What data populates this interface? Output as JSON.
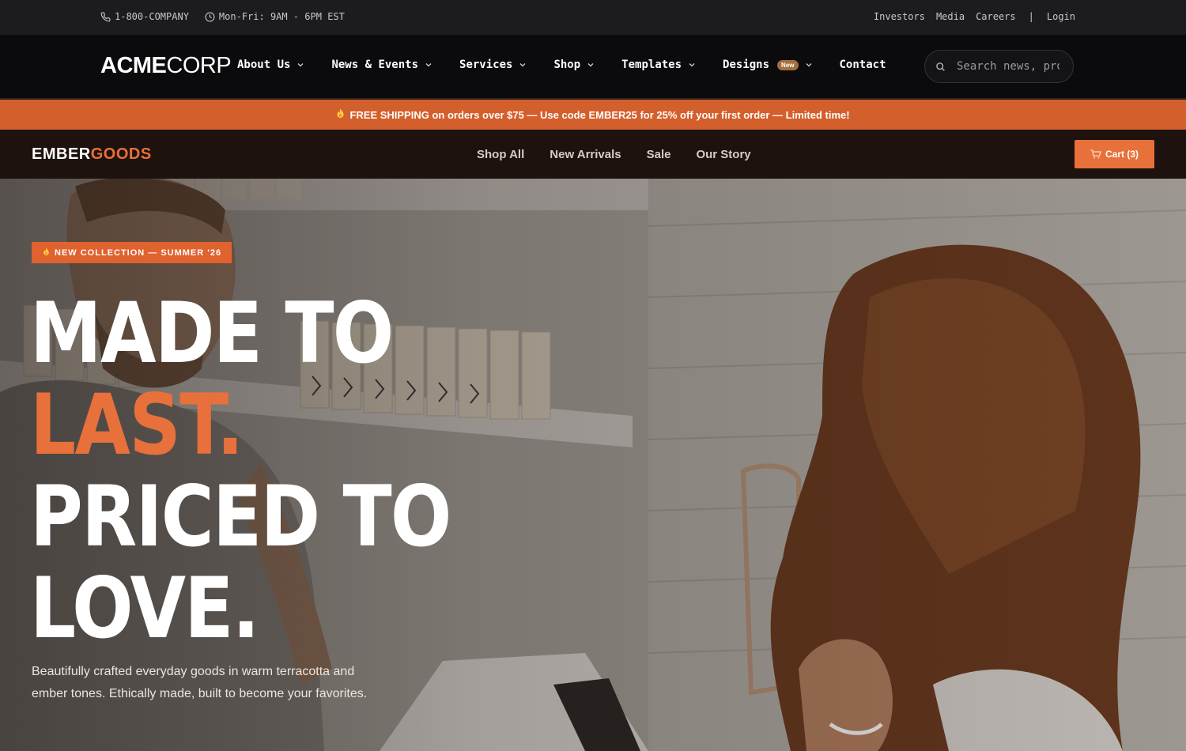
{
  "utility": {
    "phone": "1-800-COMPANY",
    "hours": "Mon-Fri: 9AM - 6PM EST",
    "links": [
      "Investors",
      "Media",
      "Careers"
    ],
    "separator": "|",
    "login": "Login",
    "phone_icon": "phone-icon",
    "clock_icon": "clock-icon"
  },
  "nav": {
    "brand_bold": "ACME",
    "brand_light": "CORP",
    "items": [
      {
        "label": "About Us",
        "dropdown": true
      },
      {
        "label": "News & Events",
        "dropdown": true
      },
      {
        "label": "Services",
        "dropdown": true
      },
      {
        "label": "Shop",
        "dropdown": true
      },
      {
        "label": "Templates",
        "dropdown": true
      },
      {
        "label": "Designs",
        "dropdown": true,
        "badge": "New"
      },
      {
        "label": "Contact",
        "dropdown": false
      }
    ],
    "search_placeholder": "Search news, products..."
  },
  "promo": {
    "icon": "fire-icon",
    "strong1": "FREE SHIPPING",
    "text1": " on orders over $75 — Use code ",
    "code": "EMBER25",
    "text2": " for 25% off your first order — Limited time!"
  },
  "store": {
    "logo_part1": "EMBER",
    "logo_part2": "GOODS",
    "links": [
      "Shop All",
      "New Arrivals",
      "Sale",
      "Our Story"
    ],
    "cart_label": "Cart (3)",
    "cart_icon": "cart-icon"
  },
  "hero": {
    "tag": "NEW COLLECTION — SUMMER '26",
    "line1": "MADE TO",
    "line2": "LAST.",
    "line3": "PRICED TO",
    "line4": "LOVE.",
    "copy": "Beautifully crafted everyday goods in warm terracotta and ember tones. Ethically made, built to become your favorites."
  },
  "colors": {
    "accent": "#e8703a",
    "promo_bg": "#d35f2c",
    "nav_bg": "#0b0b0d",
    "store_nav_bg": "#1d120e"
  }
}
